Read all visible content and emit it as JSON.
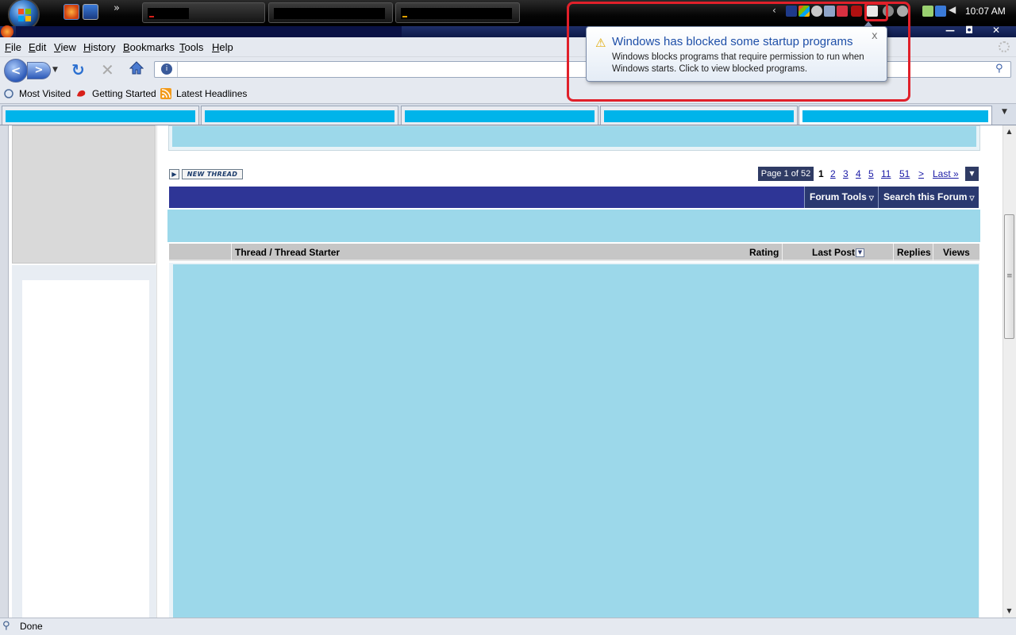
{
  "taskbar": {
    "clock": "10:07 AM",
    "quick_launch_more": "»"
  },
  "window": {
    "controls": {
      "minimize": "—",
      "maximize": "◘",
      "close": "✕"
    }
  },
  "menu": {
    "file": "File",
    "edit": "Edit",
    "view": "View",
    "history": "History",
    "bookmarks": "Bookmarks",
    "tools": "Tools",
    "help": "Help"
  },
  "nav": {
    "back": "<",
    "forward": ">",
    "reload": "↻",
    "stop": "✕",
    "url": ""
  },
  "bookmarks_bar": {
    "most_visited": "Most Visited",
    "getting_started": "Getting Started",
    "latest_headlines": "Latest Headlines"
  },
  "forum": {
    "new_thread": "NEW THREAD",
    "page_of": "Page 1 of 52",
    "pages": {
      "current": "1",
      "p2": "2",
      "p3": "3",
      "p4": "4",
      "p5": "5",
      "p11": "11",
      "p51": "51",
      "next": ">",
      "last": "Last »"
    },
    "forum_tools": "Forum Tools",
    "search_forum": "Search this Forum",
    "columns": {
      "thread": "Thread / Thread Starter",
      "rating": "Rating",
      "last_post": "Last Post",
      "replies": "Replies",
      "views": "Views"
    }
  },
  "status": {
    "text": "Done"
  },
  "notification": {
    "title": "Windows has blocked some startup programs",
    "message": "Windows blocks programs that require permission to run when Windows starts. Click to view blocked programs.",
    "close": "x"
  },
  "colors": {
    "highlight": "#e0202a",
    "tab_fill": "#00b4ea",
    "forum_bar": "#2e3596",
    "content_cyan": "#9cd8ea"
  }
}
